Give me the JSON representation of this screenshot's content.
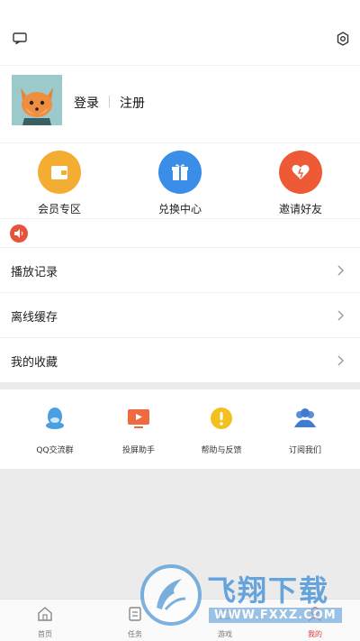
{
  "header": {
    "message_icon": "message-icon",
    "settings_icon": "settings-icon"
  },
  "profile": {
    "avatar_icon": "fox-avatar",
    "login_label": "登录",
    "register_label": "注册"
  },
  "quick_actions": [
    {
      "label": "会员专区",
      "icon": "wallet-icon",
      "color": "#f4ad33"
    },
    {
      "label": "兑换中心",
      "icon": "gift-icon",
      "color": "#3a8ee8"
    },
    {
      "label": "邀请好友",
      "icon": "heart-icon",
      "color": "#ee5a35"
    }
  ],
  "notice": {
    "icon": "speaker-icon"
  },
  "menu": [
    {
      "label": "播放记录"
    },
    {
      "label": "离线缓存"
    },
    {
      "label": "我的收藏"
    }
  ],
  "tools": [
    {
      "label": "QQ交流群",
      "icon": "qq-icon"
    },
    {
      "label": "投屏助手",
      "icon": "tv-icon"
    },
    {
      "label": "帮助与反馈",
      "icon": "help-icon"
    },
    {
      "label": "订阅我们",
      "icon": "people-icon"
    }
  ],
  "tabbar": [
    {
      "label": "首页",
      "icon": "home-icon"
    },
    {
      "label": "任务",
      "icon": "task-icon"
    },
    {
      "label": "游戏",
      "icon": "game-icon"
    },
    {
      "label": "我的",
      "icon": "profile-icon",
      "active": true
    }
  ],
  "watermark": {
    "title": "飞翔下载",
    "url": "WWW.FXXZ.COM"
  }
}
